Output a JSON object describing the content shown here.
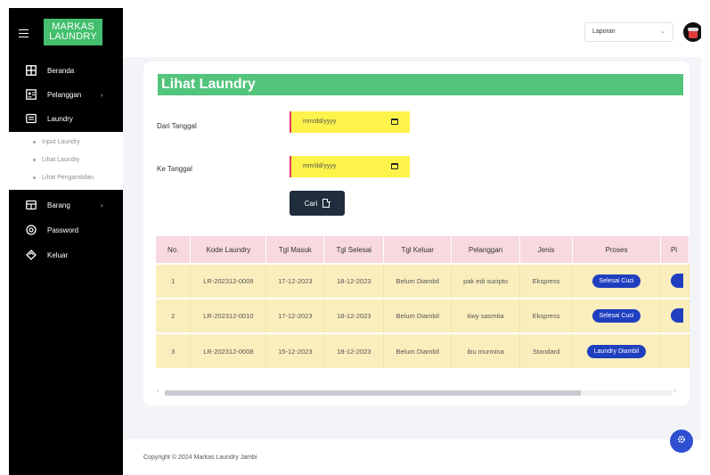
{
  "brand": {
    "line1": "MARKAS",
    "line2": "LAUNDRY"
  },
  "sidebar": {
    "items": [
      {
        "label": "Beranda",
        "icon": "grid-icon"
      },
      {
        "label": "Pelanggan",
        "icon": "id-card-icon",
        "chevron": "›"
      },
      {
        "label": "Laundry",
        "icon": "laundry-icon"
      },
      {
        "label": "Barang",
        "icon": "box-icon",
        "chevron": "›"
      },
      {
        "label": "Password",
        "icon": "at-icon"
      },
      {
        "label": "Keluar",
        "icon": "logout-icon"
      }
    ],
    "submenu": [
      "Input Laundry",
      "Lihat Laundry",
      "Lihat Pengambilan"
    ]
  },
  "topbar": {
    "select_value": "Laporan",
    "caret": "⌄"
  },
  "page": {
    "title": "Lihat Laundry",
    "from_label": "Dari Tanggal",
    "to_label": "Ke Tanggal",
    "date_placeholder": "mm/dd/yyyy",
    "search_label": "Cari"
  },
  "table": {
    "headers": [
      "No.",
      "Kode Laundry",
      "Tgl Masuk",
      "Tgl Selesai",
      "Tgl Keluar",
      "Pelanggan",
      "Jenis",
      "Proses",
      "Pi"
    ],
    "rows": [
      [
        "1",
        "LR-202312-0009",
        "17-12-2023",
        "18-12-2023",
        "Belum Diambil",
        "pak edi sucipto",
        "Ekspress",
        "Selesai Cuci"
      ],
      [
        "2",
        "LR-202312-0010",
        "17-12-2023",
        "18-12-2023",
        "Belum Diambil",
        "tiwy sasmita",
        "Ekspress",
        "Selesai Cuci"
      ],
      [
        "3",
        "LR-202312-0008",
        "15-12-2023",
        "18-12-2023",
        "Belum Diambil",
        "ibu murmina",
        "Standard",
        "Laundry Diambil"
      ]
    ]
  },
  "scroll": {
    "left": "‹",
    "right": "›"
  },
  "footer": {
    "text": "Copyright © 2024 Markas Laundry Jambi"
  },
  "colors": {
    "accent_green": "#52c47b",
    "button_blue": "#1f3fbf",
    "date_bg": "#fdf34a"
  }
}
